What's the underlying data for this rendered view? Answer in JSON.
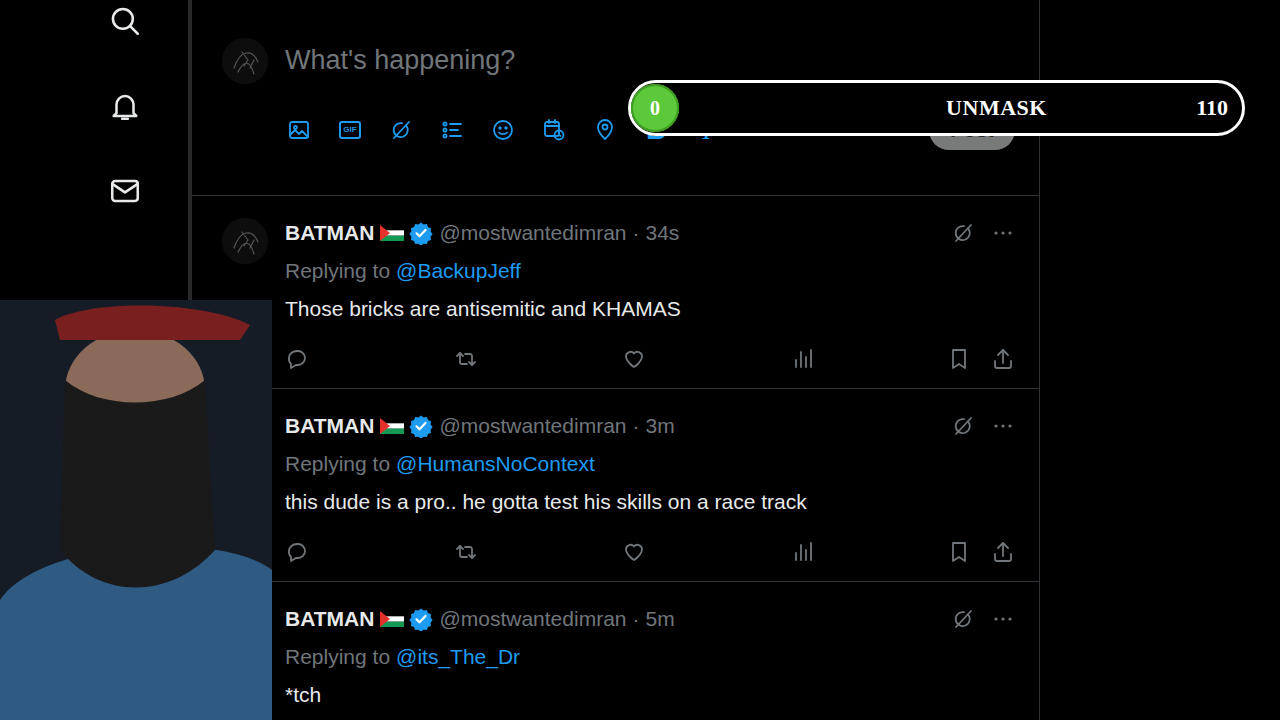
{
  "compose": {
    "placeholder": "What's happening?",
    "gif_label": "GIF",
    "bold_label": "B",
    "italic_label": "I",
    "post_button": {
      "label": "Post",
      "disabled": true
    }
  },
  "overlay": {
    "value": "0",
    "label": "UNMASK",
    "max": "110",
    "level": 0
  },
  "tweets": [
    {
      "name": "BATMAN",
      "verified": true,
      "handle": "@mostwantedimran",
      "separator": "·",
      "time": "34s",
      "replying_label": "Replying to",
      "replying_to": "@BackupJeff",
      "text": "Those bricks are antisemitic and KHAMAS"
    },
    {
      "name": "BATMAN",
      "verified": true,
      "handle": "@mostwantedimran",
      "separator": "·",
      "time": "3m",
      "replying_label": "Replying to",
      "replying_to": "@HumansNoContext",
      "text": "this dude is a pro.. he gotta test his skills on a race track"
    },
    {
      "name": "BATMAN",
      "verified": true,
      "handle": "@mostwantedimran",
      "separator": "·",
      "time": "5m",
      "replying_label": "Replying to",
      "replying_to": "@its_The_Dr",
      "text": "*tch"
    }
  ]
}
